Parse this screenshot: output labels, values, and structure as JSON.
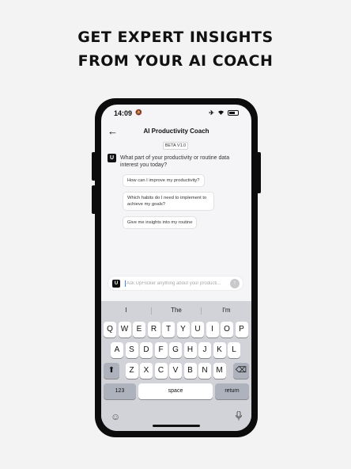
{
  "headline": {
    "line1": "GET EXPERT INSIGHTS",
    "line2": "FROM YOUR AI COACH"
  },
  "status_bar": {
    "time": "14:09"
  },
  "nav": {
    "title": "AI Productivity Coach"
  },
  "chat": {
    "badge": "BETA V1.0",
    "avatar_letter": "U",
    "question": "What part of your productivity or routine data interest you today?",
    "suggestions": [
      "How can I improve my productivity?",
      "Which habits do I need to implement to achieve my goals?",
      "Give me insights into my routine"
    ]
  },
  "composer": {
    "logo_letter": "U",
    "placeholder": "Ask UpFlicker anything about your producti..."
  },
  "keyboard": {
    "predictions": [
      "I",
      "The",
      "I'm"
    ],
    "row1": [
      "Q",
      "W",
      "E",
      "R",
      "T",
      "Y",
      "U",
      "I",
      "O",
      "P"
    ],
    "row2": [
      "A",
      "S",
      "D",
      "F",
      "G",
      "H",
      "J",
      "K",
      "L"
    ],
    "row3": [
      "Z",
      "X",
      "C",
      "V",
      "B",
      "N",
      "M"
    ],
    "numbers_key": "123",
    "space_key": "space",
    "return_key": "return"
  }
}
